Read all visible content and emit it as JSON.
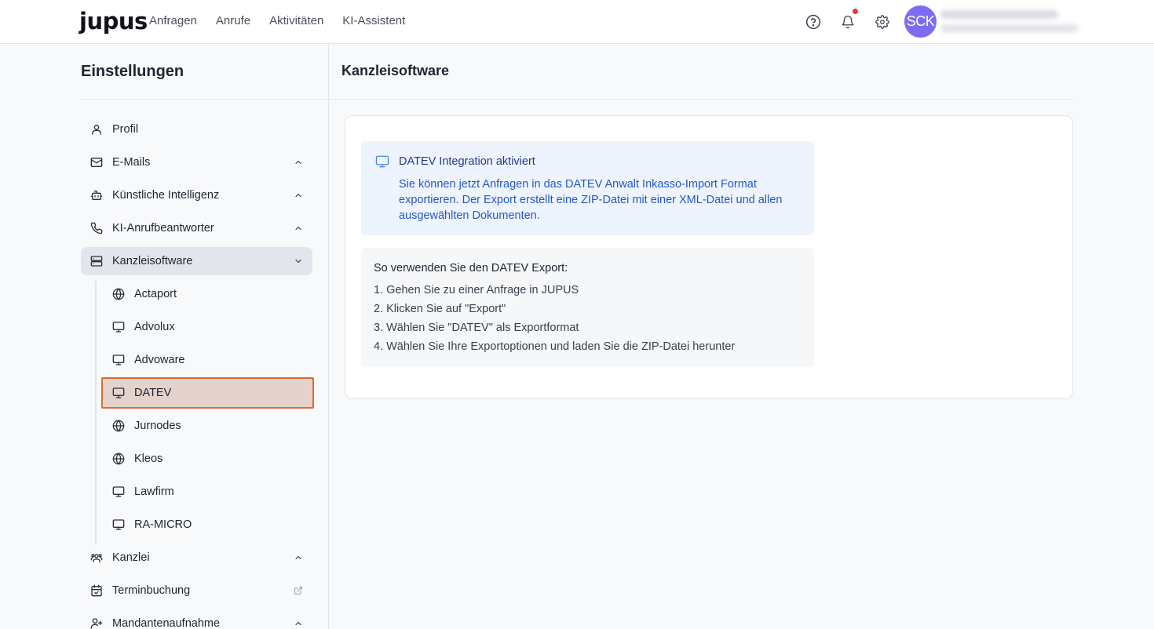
{
  "app": {
    "logo": "jupus",
    "nav": [
      "Anfragen",
      "Anrufe",
      "Aktivitäten",
      "KI-Assistent"
    ],
    "avatar_initials": "SCK",
    "icons": [
      "help-circle-icon",
      "bell-icon",
      "gear-icon"
    ],
    "notification_dot_color": "#e5393b",
    "avatar_color": "#7d6cf2"
  },
  "sidebar": {
    "title": "Einstellungen",
    "items": [
      {
        "label": "Profil",
        "icon": "user-icon",
        "chevron": "none"
      },
      {
        "label": "E-Mails",
        "icon": "mail-icon",
        "chevron": "up"
      },
      {
        "label": "Künstliche Intelligenz",
        "icon": "bot-icon",
        "chevron": "up"
      },
      {
        "label": "KI-Anrufbeantworter",
        "icon": "phone-icon",
        "chevron": "up"
      },
      {
        "label": "Kanzleisoftware",
        "icon": "server-icon",
        "chevron": "down",
        "active": true
      },
      {
        "label": "Kanzlei",
        "icon": "users-icon",
        "chevron": "up"
      },
      {
        "label": "Terminbuchung",
        "icon": "calendar-check-icon",
        "chevron": "external"
      },
      {
        "label": "Mandantenaufnahme",
        "icon": "user-plus-icon",
        "chevron": "up"
      }
    ],
    "sub_items": [
      {
        "label": "Actaport",
        "icon": "globe-icon"
      },
      {
        "label": "Advolux",
        "icon": "monitor-icon"
      },
      {
        "label": "Advoware",
        "icon": "monitor-icon"
      },
      {
        "label": "DATEV",
        "icon": "monitor-icon",
        "selected": true
      },
      {
        "label": "Jurnodes",
        "icon": "globe-icon"
      },
      {
        "label": "Kleos",
        "icon": "globe-icon"
      },
      {
        "label": "Lawfirm",
        "icon": "monitor-icon"
      },
      {
        "label": "RA-MICRO",
        "icon": "monitor-icon"
      }
    ]
  },
  "main": {
    "title": "Kanzleisoftware",
    "info": {
      "title": "DATEV Integration aktiviert",
      "text": "Sie können jetzt Anfragen in das DATEV Anwalt Inkasso-Import Format exportieren. Der Export erstellt eine ZIP-Datei mit einer XML-Datei und allen ausgewählten Dokumenten.",
      "title_color": "#1e3a8a",
      "text_color": "#2557c4",
      "background": "#eef4fd"
    },
    "howto": {
      "title": "So verwenden Sie den DATEV Export:",
      "steps": [
        "1. Gehen Sie zu einer Anfrage in JUPUS",
        "2. Klicken Sie auf \"Export\"",
        "3. Wählen Sie \"DATEV\" als Exportformat",
        "4. Wählen Sie Ihre Exportoptionen und laden Sie die ZIP-Datei herunter"
      ]
    }
  }
}
